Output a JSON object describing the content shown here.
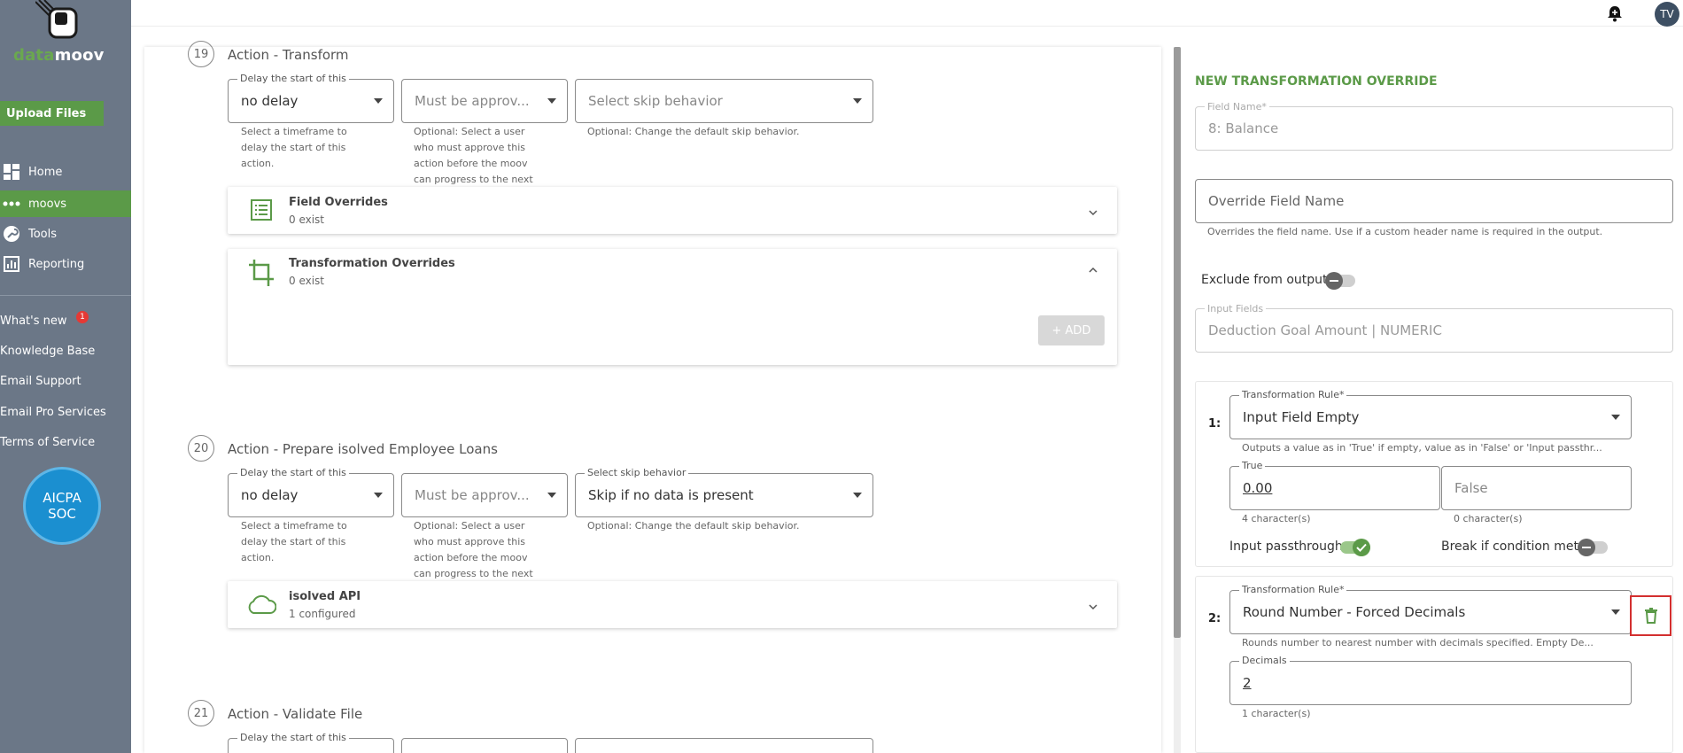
{
  "brand": {
    "name_part1": "data",
    "name_part2": "moov"
  },
  "sidebar": {
    "upload_label": "Upload Files",
    "nav": [
      {
        "label": "Home",
        "icon": "dashboard-icon"
      },
      {
        "label": "moovs",
        "icon": "dots-icon"
      },
      {
        "label": "Tools",
        "icon": "wrench-icon"
      },
      {
        "label": "Reporting",
        "icon": "chart-icon"
      }
    ],
    "links": [
      "What's new",
      "Knowledge Base",
      "Email Support",
      "Email Pro Services",
      "Terms of Service"
    ],
    "whats_new_count": "1",
    "aicpa": {
      "line1": "AICPA",
      "line2": "SOC"
    }
  },
  "topbar": {
    "avatar_initials": "TV"
  },
  "steps": [
    {
      "number": "19",
      "title": "Action - Transform",
      "delay_label": "Delay the start of this",
      "delay_value": "no delay",
      "delay_help": "Select a timeframe to delay the start of this action.",
      "approve_placeholder": "Must be approv...",
      "approve_help": "Optional: Select a user who must approve this action before the moov can progress to the next",
      "skip_value": "Select skip behavior",
      "skip_help": "Optional: Change the default skip behavior.",
      "cards": [
        {
          "title": "Field Overrides",
          "sub": "0 exist",
          "icon": "list-icon"
        },
        {
          "title": "Transformation Overrides",
          "sub": "0 exist",
          "icon": "crop-icon"
        }
      ],
      "add_label": "+ ADD"
    },
    {
      "number": "20",
      "title": "Action - Prepare isolved Employee Loans",
      "delay_label": "Delay the start of this",
      "delay_value": "no delay",
      "delay_help": "Select a timeframe to delay the start of this action.",
      "approve_placeholder": "Must be approv...",
      "approve_help": "Optional: Select a user who must approve this action before the moov can progress to the next",
      "skip_label": "Select skip behavior",
      "skip_value": "Skip if no data is present",
      "skip_help": "Optional: Change the default skip behavior.",
      "cards": [
        {
          "title": "isolved API",
          "sub": "1 configured",
          "icon": "cloud-icon"
        }
      ]
    },
    {
      "number": "21",
      "title": "Action - Validate File",
      "delay_label": "Delay the start of this"
    }
  ],
  "override": {
    "title": "NEW TRANSFORMATION OVERRIDE",
    "field_name_label": "Field Name*",
    "field_name_value": "8: Balance",
    "override_placeholder": "Override Field Name",
    "override_help": "Overrides the field name. Use if a custom header name is required in the output.",
    "exclude_label": "Exclude from output",
    "input_fields_label": "Input Fields",
    "input_fields_value": "Deduction Goal Amount | NUMERIC",
    "rules": [
      {
        "num": "1:",
        "label": "Transformation Rule*",
        "value": "Input Field Empty",
        "help": "Outputs a value as in 'True' if empty, value as in 'False' or 'Input passthr...",
        "true_label": "True",
        "true_value": "0.00",
        "true_count": "4 character(s)",
        "false_placeholder": "False",
        "false_count": "0 character(s)",
        "passthrough_label": "Input passthrough",
        "break_label": "Break if condition met"
      },
      {
        "num": "2:",
        "label": "Transformation Rule*",
        "value": "Round Number - Forced Decimals",
        "help": "Rounds number to nearest number with decimals specified. Empty De...",
        "decimals_label": "Decimals",
        "decimals_value": "2",
        "decimals_count": "1 character(s)"
      }
    ]
  }
}
